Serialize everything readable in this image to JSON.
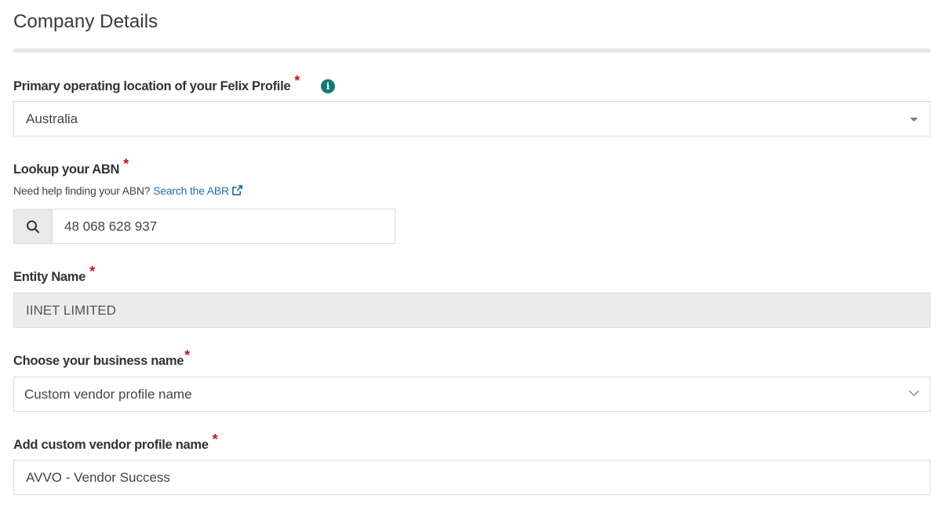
{
  "section": {
    "title": "Company Details"
  },
  "location": {
    "label": "Primary operating location of your Felix Profile",
    "required_mark": "*",
    "info_icon": "info-circle-icon",
    "value": "Australia"
  },
  "abn": {
    "label": "Lookup your ABN",
    "required_mark": "*",
    "help_text": "Need help finding your ABN?",
    "help_link": "Search the ABR",
    "link_icon": "external-link-icon",
    "search_icon": "search-icon",
    "value": "48 068 628 937"
  },
  "entity": {
    "label": "Entity Name",
    "required_mark": "*",
    "value": "IINET LIMITED"
  },
  "business_name": {
    "label": "Choose your business name",
    "required_mark": "*",
    "value": "Custom vendor profile name"
  },
  "custom_name": {
    "label": "Add custom vendor profile name",
    "required_mark": "*",
    "value": "AVVO - Vendor Success"
  },
  "colors": {
    "required": "#c0141c",
    "info_icon": "#137a70",
    "link": "#1f6fa8",
    "disabled_bg": "#ececec",
    "divider": "#e6e6e6"
  }
}
